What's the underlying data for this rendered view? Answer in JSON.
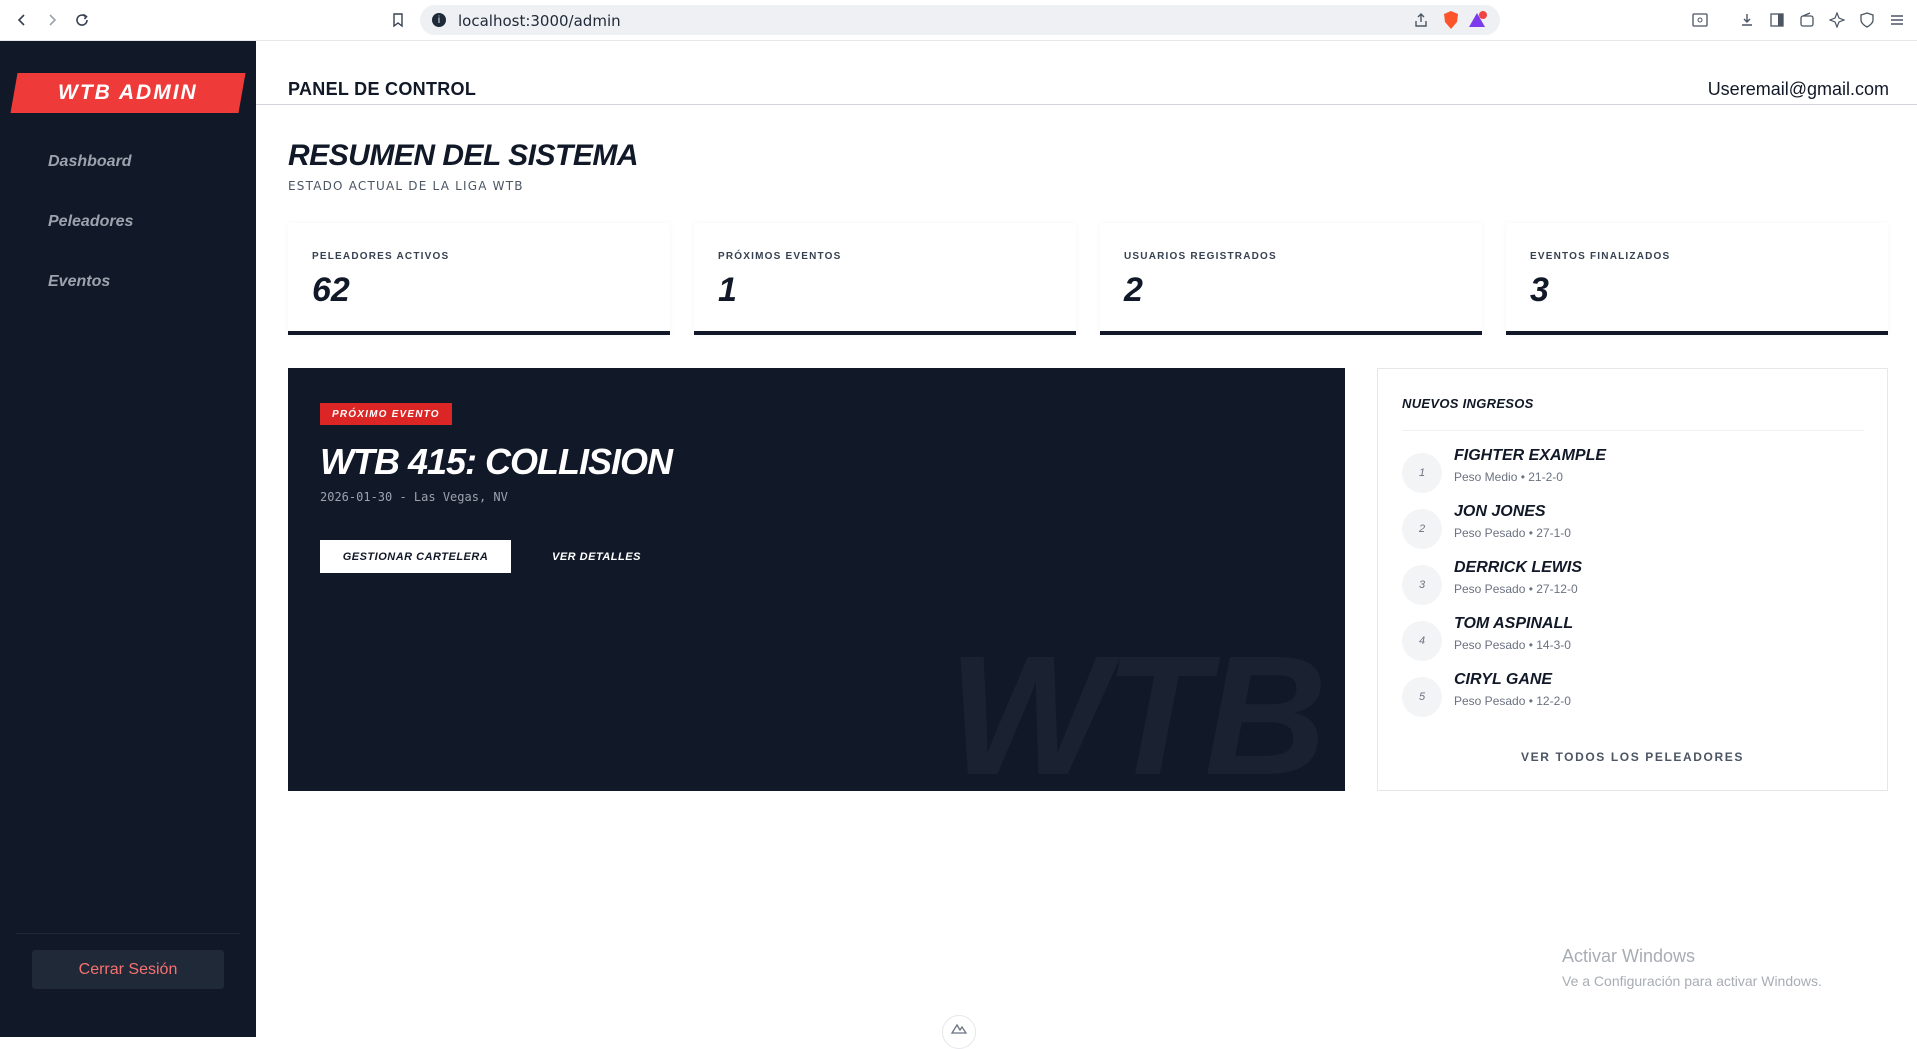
{
  "browser": {
    "url": "localhost:3000/admin",
    "badge_count": "1"
  },
  "sidebar": {
    "logo": "WTB ADMIN",
    "items": [
      {
        "label": "Dashboard"
      },
      {
        "label": "Peleadores"
      },
      {
        "label": "Eventos"
      }
    ],
    "logout_label": "Cerrar Sesión"
  },
  "header": {
    "title": "PANEL DE CONTROL",
    "user_email": "Useremail@gmail.com"
  },
  "main": {
    "title": "RESUMEN DEL SISTEMA",
    "subtitle": "ESTADO ACTUAL DE LA LIGA WTB",
    "stats": [
      {
        "label": "PELEADORES ACTIVOS",
        "value": "62"
      },
      {
        "label": "PRÓXIMOS EVENTOS",
        "value": "1"
      },
      {
        "label": "USUARIOS REGISTRADOS",
        "value": "2"
      },
      {
        "label": "EVENTOS FINALIZADOS",
        "value": "3"
      }
    ],
    "event": {
      "badge": "PRÓXIMO EVENTO",
      "title": "WTB 415: COLLISION",
      "meta": "2026-01-30 - Las Vegas, NV",
      "manage_label": "GESTIONAR CARTELERA",
      "details_label": "VER DETALLES",
      "watermark": "WTB"
    },
    "newcomers": {
      "title": "NUEVOS INGRESOS",
      "items": [
        {
          "rank": "1",
          "name": "FIGHTER EXAMPLE",
          "info": "Peso Medio • 21-2-0"
        },
        {
          "rank": "2",
          "name": "JON JONES",
          "info": "Peso Pesado • 27-1-0"
        },
        {
          "rank": "3",
          "name": "DERRICK LEWIS",
          "info": "Peso Pesado • 27-12-0"
        },
        {
          "rank": "4",
          "name": "TOM ASPINALL",
          "info": "Peso Pesado • 14-3-0"
        },
        {
          "rank": "5",
          "name": "CIRYL GANE",
          "info": "Peso Pesado • 12-2-0"
        }
      ],
      "view_all_label": "VER TODOS LOS PELEADORES"
    }
  },
  "watermark_windows": {
    "line1": "Activar Windows",
    "line2": "Ve a Configuración para activar Windows."
  }
}
